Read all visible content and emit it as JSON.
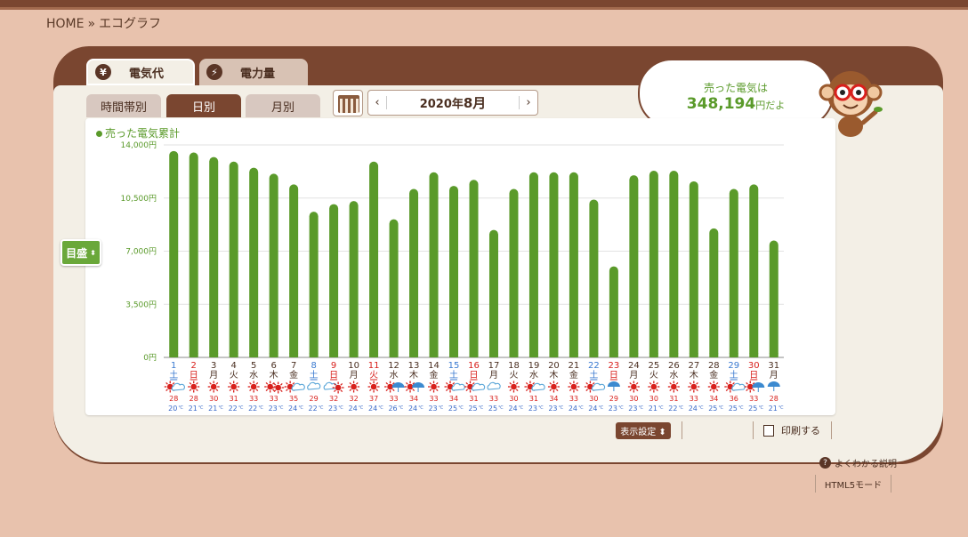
{
  "breadcrumb": {
    "home": "HOME",
    "sep": "»",
    "current": "エコグラフ"
  },
  "tabs": {
    "cost": "電気代",
    "power": "電力量"
  },
  "subtabs": {
    "time": "時間帯別",
    "day": "日別",
    "month": "月別"
  },
  "month_nav": {
    "prev": "‹",
    "next": "›",
    "year_label": "2020年",
    "month_label": "8月"
  },
  "speech": {
    "line1": "売った電気は",
    "amount": "348,194",
    "suffix": "円だよ"
  },
  "scale_button": {
    "label": "目盛",
    "arrows": "⬍"
  },
  "buttons": {
    "display_settings": "表示設定 ⬍",
    "print": "印刷する",
    "help": "よくわかる説明",
    "html5": "HTML5モード"
  },
  "colors": {
    "bar": "#5a9a2a",
    "sun": "#d8201c",
    "cloud": "#5aa6d8",
    "rain": "#3c8ad0",
    "sat": "#3a7ad0",
    "sun_day": "#d8201c",
    "weekday": "#4a2e20"
  },
  "chart_data": {
    "type": "bar",
    "title": "売った電気累計",
    "yticks": [
      "0円",
      "3,500円",
      "7,000円",
      "10,500円",
      "14,000円"
    ],
    "ylim": [
      0,
      14000
    ],
    "grid": true,
    "days": [
      1,
      2,
      3,
      4,
      5,
      6,
      7,
      8,
      9,
      10,
      11,
      12,
      13,
      14,
      15,
      16,
      17,
      18,
      19,
      20,
      21,
      22,
      23,
      24,
      25,
      26,
      27,
      28,
      29,
      30,
      31
    ],
    "weekdays": [
      "土",
      "日",
      "月",
      "火",
      "水",
      "木",
      "金",
      "土",
      "日",
      "月",
      "火",
      "水",
      "木",
      "金",
      "土",
      "日",
      "月",
      "火",
      "水",
      "木",
      "金",
      "土",
      "日",
      "月",
      "火",
      "水",
      "木",
      "金",
      "土",
      "日",
      "月"
    ],
    "day_types": [
      "sat",
      "sun",
      "wk",
      "wk",
      "wk",
      "wk",
      "wk",
      "sat",
      "sun",
      "wk",
      "hol",
      "wk",
      "wk",
      "wk",
      "sat",
      "sun",
      "wk",
      "wk",
      "wk",
      "wk",
      "wk",
      "sat",
      "sun",
      "wk",
      "wk",
      "wk",
      "wk",
      "wk",
      "sat",
      "sun",
      "wk"
    ],
    "values": [
      13600,
      13500,
      13200,
      12900,
      12500,
      12100,
      11400,
      9600,
      10100,
      10300,
      12900,
      9100,
      11100,
      12200,
      11300,
      11700,
      8400,
      11100,
      12200,
      12200,
      12200,
      10400,
      6000,
      12000,
      12300,
      12300,
      11600,
      8500,
      11100,
      11400,
      7700
    ],
    "weather": [
      "sun-cloud",
      "sun",
      "sun",
      "sun",
      "sun",
      "sun-sun",
      "sun-cloud",
      "cloud",
      "cloud-sun",
      "sun",
      "sun",
      "sun-rain",
      "sun-rain",
      "sun",
      "sun-cloud",
      "sun-cloud",
      "cloud",
      "sun",
      "sun-cloud",
      "sun",
      "sun",
      "sun-cloud",
      "rain",
      "sun",
      "sun",
      "sun",
      "sun",
      "sun",
      "sun-cloud",
      "sun-rain",
      "rain"
    ],
    "temp_high": [
      28,
      28,
      30,
      31,
      33,
      33,
      35,
      29,
      32,
      32,
      37,
      33,
      34,
      33,
      34,
      31,
      33,
      30,
      31,
      34,
      33,
      30,
      29,
      30,
      30,
      31,
      33,
      34,
      36,
      33,
      28
    ],
    "temp_low": [
      20,
      21,
      21,
      22,
      22,
      23,
      24,
      22,
      23,
      24,
      24,
      26,
      24,
      23,
      25,
      25,
      25,
      24,
      23,
      23,
      24,
      24,
      23,
      23,
      21,
      22,
      24,
      25,
      25,
      25,
      21
    ],
    "temp_unit": "℃"
  }
}
